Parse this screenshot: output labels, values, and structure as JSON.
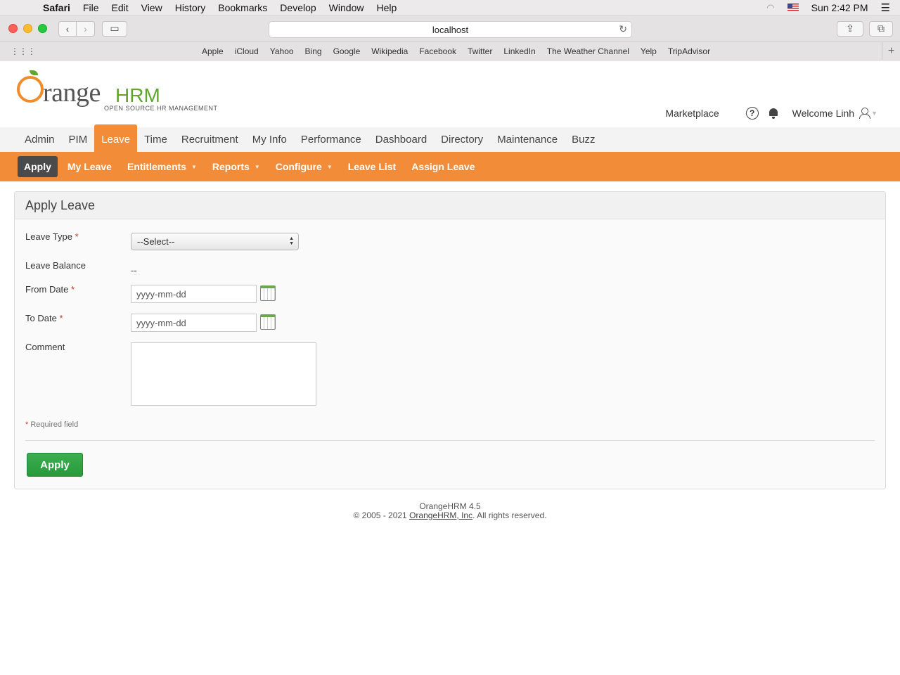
{
  "menubar": {
    "app": "Safari",
    "items": [
      "File",
      "Edit",
      "View",
      "History",
      "Bookmarks",
      "Develop",
      "Window",
      "Help"
    ],
    "clock": "Sun 2:42 PM"
  },
  "browser": {
    "url": "localhost",
    "favorites": [
      "Apple",
      "iCloud",
      "Yahoo",
      "Bing",
      "Google",
      "Wikipedia",
      "Facebook",
      "Twitter",
      "LinkedIn",
      "The Weather Channel",
      "Yelp",
      "TripAdvisor"
    ]
  },
  "brand": {
    "logo_main": "range",
    "logo_hrm": "HRM",
    "logo_sub": "OPEN SOURCE HR MANAGEMENT"
  },
  "header": {
    "marketplace": "Marketplace",
    "help": "?",
    "welcome": "Welcome Linh"
  },
  "mainnav": {
    "items": [
      "Admin",
      "PIM",
      "Leave",
      "Time",
      "Recruitment",
      "My Info",
      "Performance",
      "Dashboard",
      "Directory",
      "Maintenance",
      "Buzz"
    ],
    "active": "Leave"
  },
  "subnav": {
    "apply": "Apply",
    "my_leave": "My Leave",
    "entitlements": "Entitlements",
    "reports": "Reports",
    "configure": "Configure",
    "leave_list": "Leave List",
    "assign_leave": "Assign Leave"
  },
  "form": {
    "title": "Apply Leave",
    "leave_type_label": "Leave Type",
    "leave_type_value": "--Select--",
    "leave_balance_label": "Leave Balance",
    "leave_balance_value": "--",
    "from_date_label": "From Date",
    "from_date_placeholder": "yyyy-mm-dd",
    "to_date_label": "To Date",
    "to_date_placeholder": "yyyy-mm-dd",
    "comment_label": "Comment",
    "required_marker": "*",
    "required_note": "Required field",
    "apply_button": "Apply"
  },
  "footer": {
    "version": "OrangeHRM 4.5",
    "copyright_prefix": "© 2005 - 2021 ",
    "company_link": "OrangeHRM, Inc",
    "copyright_suffix": ". All rights reserved."
  },
  "colors": {
    "orange": "#f28c38",
    "green_button": "#2da44e",
    "active_subnav": "#4a4a4a",
    "logo_green": "#5fa52f"
  }
}
